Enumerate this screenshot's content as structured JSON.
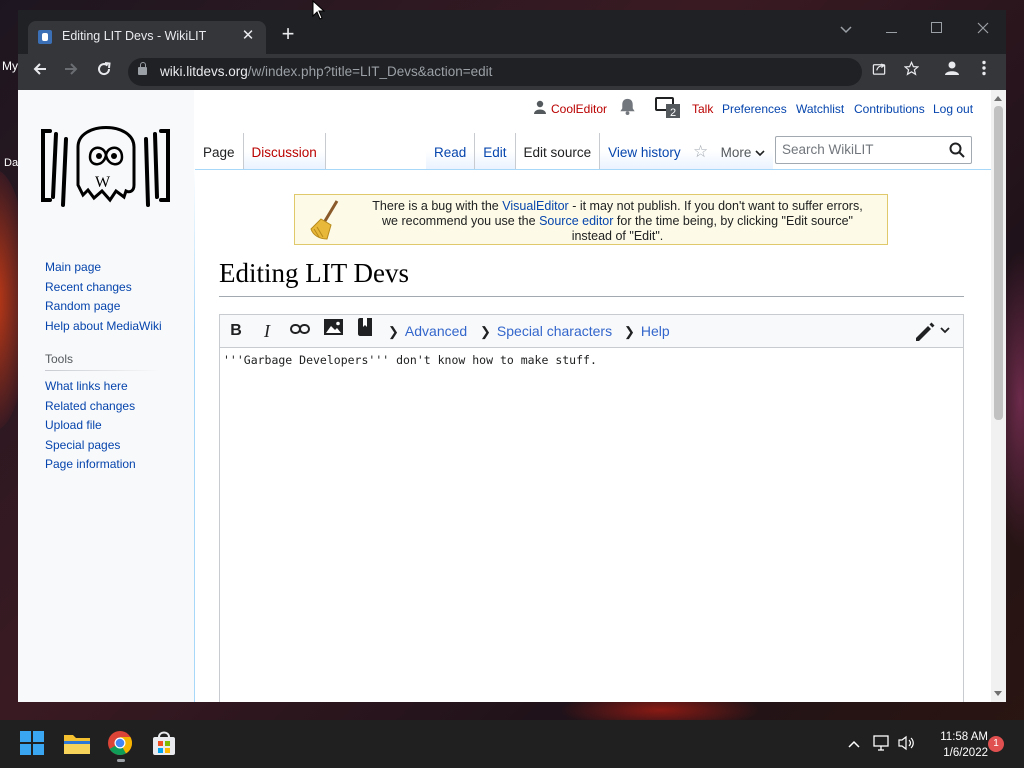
{
  "desktop": {
    "fragments": [
      "My",
      "Da"
    ]
  },
  "browser": {
    "tab_title": "Editing LIT Devs - WikiLIT",
    "url_host": "wiki.litdevs.org",
    "url_path": "/w/index.php?title=LIT_Devs&action=edit"
  },
  "personal": {
    "username": "CoolEditor",
    "notice_count": "2",
    "talk": "Talk",
    "preferences": "Preferences",
    "watchlist": "Watchlist",
    "contributions": "Contributions",
    "logout": "Log out"
  },
  "tabs": {
    "page": "Page",
    "discussion": "Discussion",
    "read": "Read",
    "edit": "Edit",
    "edit_source": "Edit source",
    "view_history": "View history",
    "more": "More"
  },
  "search": {
    "placeholder": "Search WikiLIT"
  },
  "sitenotice": {
    "t1": "There is a bug with the ",
    "link1": "VisualEditor",
    "t2": " - it may not publish. If you don't want to suffer errors,",
    "t3": "we recommend you use the ",
    "link2": "Source editor",
    "t4": " for the time being, by clicking \"Edit source\"",
    "t5": "instead of \"Edit\"."
  },
  "sidebar": {
    "nav": [
      "Main page",
      "Recent changes",
      "Random page",
      "Help about MediaWiki"
    ],
    "tools_heading": "Tools",
    "tools": [
      "What links here",
      "Related changes",
      "Upload file",
      "Special pages",
      "Page information"
    ]
  },
  "page": {
    "title": "Editing LIT Devs"
  },
  "editor": {
    "bold": "B",
    "italic": "I",
    "advanced": "Advanced",
    "special_characters": "Special characters",
    "help": "Help",
    "content": "'''Garbage Developers''' don't know how to make stuff."
  },
  "taskbar": {
    "time": "11:58 AM",
    "date": "1/6/2022",
    "notification_count": "1"
  }
}
